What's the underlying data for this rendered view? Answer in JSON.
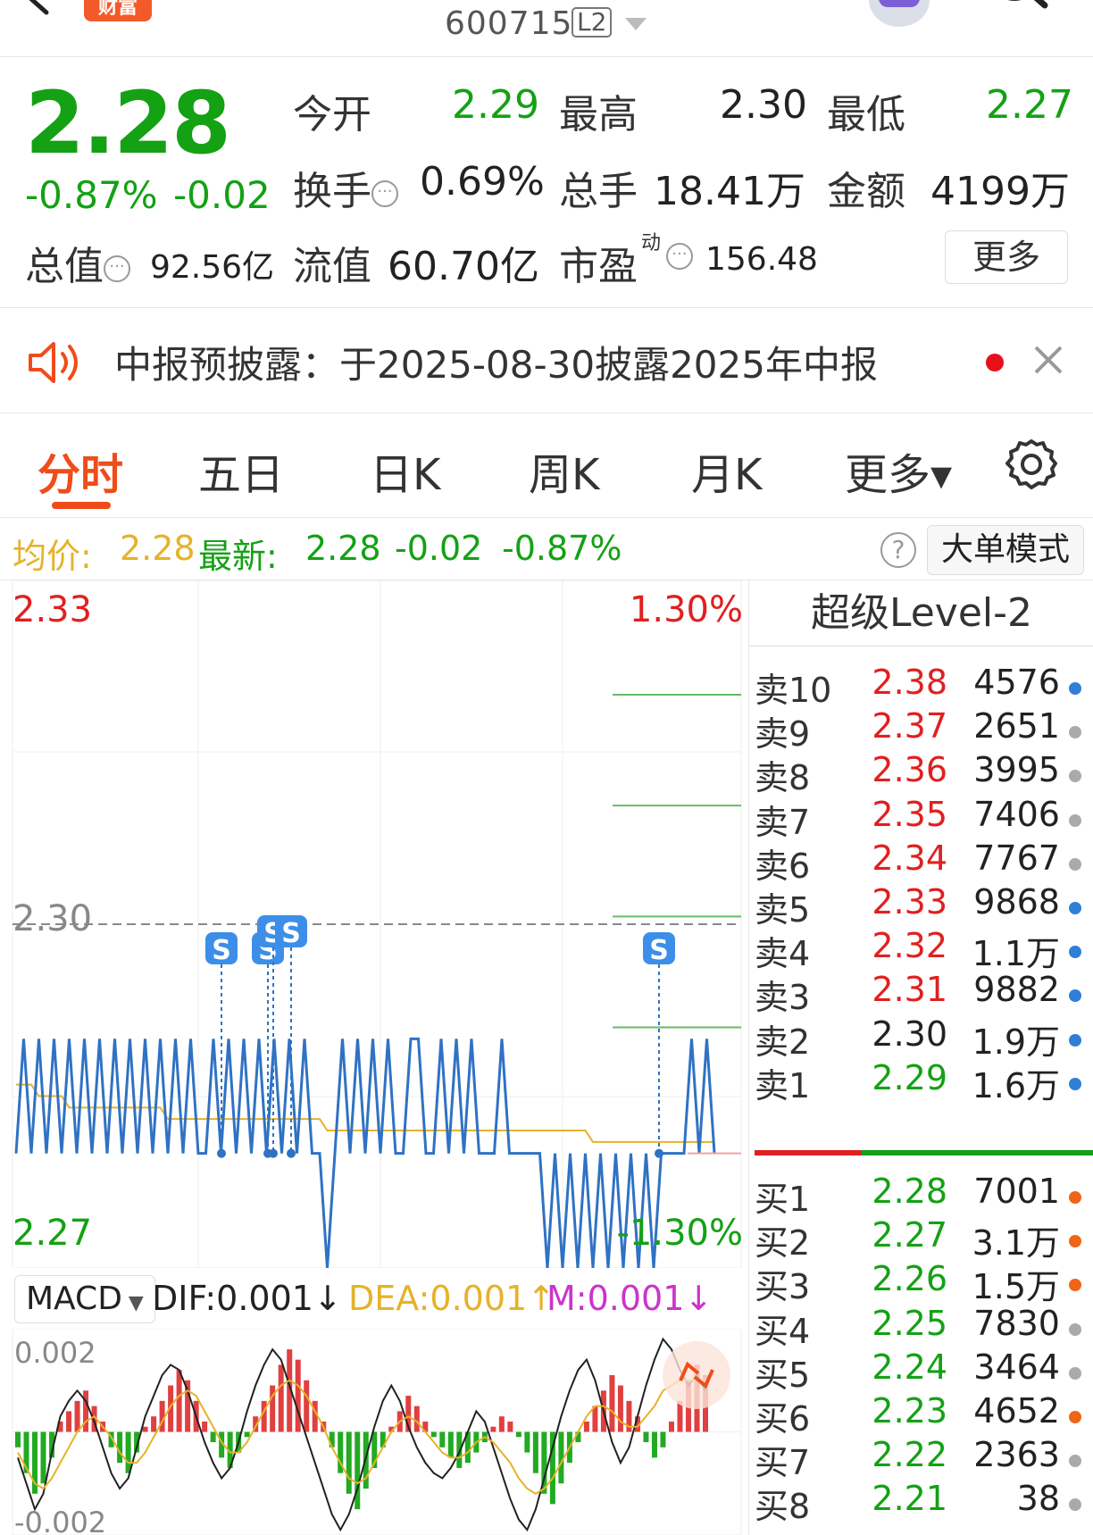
{
  "header": {
    "brand_text": "财富",
    "stock_code": "600715",
    "level_badge": "L2"
  },
  "quote": {
    "price": "2.28",
    "change_pct": "-0.87%",
    "change_amt": "-0.02",
    "open_label": "今开",
    "open_value": "2.29",
    "high_label": "最高",
    "high_value": "2.30",
    "low_label": "最低",
    "low_value": "2.27",
    "turnover_label": "换手",
    "turnover_value": "0.69%",
    "volume_label": "总手",
    "volume_value": "18.41万",
    "amount_label": "金额",
    "amount_value": "4199万",
    "mktcap_label": "总值",
    "mktcap_value": "92.56亿",
    "float_label": "流值",
    "float_value": "60.70亿",
    "pe_label": "市盈",
    "pe_sup": "动",
    "pe_value": "156.48",
    "more_label": "更多"
  },
  "notice": {
    "text": "中报预披露：于2025-08-30披露2025年中报"
  },
  "tabs": [
    {
      "label": "分时"
    },
    {
      "label": "五日"
    },
    {
      "label": "日K"
    },
    {
      "label": "周K"
    },
    {
      "label": "月K"
    },
    {
      "label": "更多▾"
    }
  ],
  "chart_info": {
    "avg_label": "均价:",
    "avg_value": "2.28",
    "latest_label": "最新:",
    "latest_value": "2.28",
    "latest_change": "-0.02",
    "latest_pct": "-0.87%",
    "help_label": "?",
    "big_order_label": "大单模式"
  },
  "chart_data": [
    {
      "type": "line",
      "y_top_label": "2.33",
      "y_mid_label": "2.30",
      "y_bottom_label": "2.27",
      "pct_top_label": "1.30%",
      "pct_bottom_label": "-1.30%",
      "ylim": [
        2.27,
        2.33
      ],
      "reference_price": 2.3,
      "s_marker_label": "S",
      "series": [
        {
          "values": [
            2.28,
            2.29,
            2.28,
            2.29,
            2.28,
            2.29,
            2.28,
            2.29,
            2.28,
            2.29,
            2.28,
            2.29,
            2.28,
            2.29,
            2.28,
            2.29,
            2.28,
            2.29,
            2.28,
            2.29,
            2.28,
            2.29,
            2.28,
            2.29,
            2.28,
            2.28,
            2.29,
            2.28,
            2.29,
            2.28,
            2.29,
            2.28,
            2.29,
            2.28,
            2.29,
            2.28,
            2.29,
            2.28,
            2.29,
            2.28,
            2.28,
            2.27,
            2.28,
            2.29,
            2.28,
            2.29,
            2.28,
            2.29,
            2.28,
            2.29,
            2.28,
            2.28,
            2.29,
            2.29,
            2.28,
            2.28,
            2.29,
            2.28,
            2.29,
            2.28,
            2.29,
            2.28,
            2.28,
            2.28,
            2.29,
            2.28,
            2.28,
            2.28,
            2.28,
            2.28,
            2.27,
            2.28,
            2.27,
            2.28,
            2.27,
            2.28,
            2.27,
            2.28,
            2.27,
            2.28,
            2.27,
            2.28,
            2.27,
            2.28,
            2.27,
            2.28,
            2.28,
            2.28,
            2.28,
            2.29,
            2.28,
            2.29,
            2.28
          ]
        },
        {
          "values": [
            2.286,
            2.286,
            2.286,
            2.285,
            2.285,
            2.285,
            2.285,
            2.284,
            2.284,
            2.284,
            2.284,
            2.284,
            2.284,
            2.284,
            2.284,
            2.284,
            2.284,
            2.284,
            2.284,
            2.284,
            2.283,
            2.283,
            2.283,
            2.283,
            2.283,
            2.283,
            2.283,
            2.283,
            2.283,
            2.283,
            2.283,
            2.283,
            2.283,
            2.283,
            2.283,
            2.283,
            2.283,
            2.283,
            2.283,
            2.283,
            2.283,
            2.282,
            2.282,
            2.282,
            2.282,
            2.282,
            2.282,
            2.282,
            2.282,
            2.282,
            2.282,
            2.282,
            2.282,
            2.282,
            2.282,
            2.282,
            2.282,
            2.282,
            2.282,
            2.282,
            2.282,
            2.282,
            2.282,
            2.282,
            2.282,
            2.282,
            2.282,
            2.282,
            2.282,
            2.282,
            2.282,
            2.282,
            2.282,
            2.282,
            2.282,
            2.282,
            2.281,
            2.281,
            2.281,
            2.281,
            2.281,
            2.281,
            2.281,
            2.281,
            2.281,
            2.281,
            2.281,
            2.281,
            2.281,
            2.281,
            2.281,
            2.281,
            2.281
          ]
        }
      ]
    },
    {
      "type": "bar",
      "indicator": "MACD",
      "dif_text": "DIF:0.001↓",
      "dea_text": "DEA:0.001↑",
      "m_text": "M:0.001↓",
      "y_top_label": "0.002",
      "y_bottom_label": "-0.002",
      "ylim": [
        -0.002,
        0.002
      ],
      "series": [
        {
          "values": [
            -0.0003,
            -0.0008,
            -0.0012,
            -0.001,
            -0.0005,
            0.0002,
            0.0004,
            0.0006,
            0.0008,
            0.0005,
            0.0002,
            -0.0003,
            -0.0006,
            -0.0008,
            -0.0004,
            0.0001,
            0.0003,
            0.0006,
            0.0009,
            0.0012,
            0.001,
            0.0006,
            0.0002,
            -0.0002,
            -0.0005,
            -0.0007,
            -0.0004,
            -0.0001,
            0.0003,
            0.0006,
            0.0009,
            0.0013,
            0.0016,
            0.0014,
            0.001,
            0.0006,
            0.0002,
            -0.0003,
            -0.0008,
            -0.0012,
            -0.0015,
            -0.0011,
            -0.0007,
            -0.0003,
            0.0001,
            0.0004,
            0.0007,
            0.0005,
            0.0002,
            -0.0001,
            -0.0003,
            -0.0005,
            -0.0007,
            -0.0006,
            -0.0004,
            -0.0002,
            0.0001,
            0.0003,
            0.0002,
            -0.0001,
            -0.0004,
            -0.0008,
            -0.0012,
            -0.0014,
            -0.001,
            -0.0006,
            -0.0002,
            0.0002,
            0.0005,
            0.0008,
            0.0011,
            0.0009,
            0.0006,
            0.0003,
            -0.0002,
            -0.0005,
            -0.0003,
            0.0002,
            0.0006,
            0.001,
            0.0013,
            0.0011
          ]
        },
        {
          "values": [
            -0.0005,
            -0.001,
            -0.0015,
            -0.0012,
            -0.0004,
            0.0003,
            0.0006,
            0.0008,
            0.0006,
            0.0002,
            -0.0003,
            -0.0008,
            -0.0011,
            -0.0009,
            -0.0003,
            0.0003,
            0.0007,
            0.0011,
            0.0013,
            0.0012,
            0.0008,
            0.0003,
            -0.0002,
            -0.0006,
            -0.0009,
            -0.0007,
            -0.0002,
            0.0004,
            0.0009,
            0.0013,
            0.0016,
            0.0014,
            0.0009,
            0.0004,
            -0.0001,
            -0.0006,
            -0.0011,
            -0.0016,
            -0.0019,
            -0.0016,
            -0.0011,
            -0.0005,
            0.0001,
            0.0006,
            0.0009,
            0.0006,
            0.0001,
            -0.0003,
            -0.0006,
            -0.0008,
            -0.0009,
            -0.0007,
            -0.0004,
            0.0,
            0.0004,
            0.0002,
            -0.0003,
            -0.0008,
            -0.0013,
            -0.0017,
            -0.0019,
            -0.0015,
            -0.0009,
            -0.0003,
            0.0003,
            0.0008,
            0.0012,
            0.0014,
            0.001,
            0.0004,
            -0.0002,
            -0.0006,
            -0.0003,
            0.0003,
            0.0009,
            0.0014,
            0.0018,
            0.0016,
            0.0012,
            0.0009,
            0.0011,
            0.0008
          ]
        },
        {
          "values": [
            -0.0004,
            -0.0007,
            -0.001,
            -0.0011,
            -0.0009,
            -0.0006,
            -0.0003,
            0.0,
            0.0002,
            0.0003,
            0.0001,
            -0.0001,
            -0.0004,
            -0.0006,
            -0.0006,
            -0.0004,
            -0.0001,
            0.0002,
            0.0005,
            0.0007,
            0.0008,
            0.0007,
            0.0004,
            0.0001,
            -0.0002,
            -0.0004,
            -0.0004,
            -0.0002,
            0.0001,
            0.0004,
            0.0007,
            0.0009,
            0.001,
            0.0009,
            0.0007,
            0.0004,
            0.0001,
            -0.0003,
            -0.0006,
            -0.0009,
            -0.001,
            -0.0009,
            -0.0006,
            -0.0003,
            0.0,
            0.0002,
            0.0003,
            0.0002,
            0.0,
            -0.0002,
            -0.0004,
            -0.0005,
            -0.0005,
            -0.0004,
            -0.0002,
            -0.0001,
            -0.0002,
            -0.0004,
            -0.0006,
            -0.0009,
            -0.0011,
            -0.0012,
            -0.0011,
            -0.0009,
            -0.0006,
            -0.0003,
            0.0,
            0.0003,
            0.0005,
            0.0005,
            0.0004,
            0.0002,
            0.0001,
            0.0001,
            0.0003,
            0.0005,
            0.0008,
            0.0009,
            0.001,
            0.001,
            0.001,
            0.001
          ]
        }
      ]
    }
  ],
  "orderbook": {
    "title": "超级Level-2",
    "sell": [
      {
        "label": "卖10",
        "price": "2.38",
        "vol": "4576",
        "dot": "#2f7fd8"
      },
      {
        "label": "卖9",
        "price": "2.37",
        "vol": "2651",
        "dot": "#aaaaaa"
      },
      {
        "label": "卖8",
        "price": "2.36",
        "vol": "3995",
        "dot": "#aaaaaa"
      },
      {
        "label": "卖7",
        "price": "2.35",
        "vol": "7406",
        "dot": "#aaaaaa"
      },
      {
        "label": "卖6",
        "price": "2.34",
        "vol": "7767",
        "dot": "#aaaaaa"
      },
      {
        "label": "卖5",
        "price": "2.33",
        "vol": "9868",
        "dot": "#2f7fd8"
      },
      {
        "label": "卖4",
        "price": "2.32",
        "vol": "1.1万",
        "dot": "#2f7fd8"
      },
      {
        "label": "卖3",
        "price": "2.31",
        "vol": "9882",
        "dot": "#2f7fd8"
      },
      {
        "label": "卖2",
        "price": "2.30",
        "vol": "1.9万",
        "dot": "#2f7fd8"
      },
      {
        "label": "卖1",
        "price": "2.29",
        "vol": "1.6万",
        "dot": "#2f7fd8"
      }
    ],
    "buy": [
      {
        "label": "买1",
        "price": "2.28",
        "vol": "7001",
        "dot": "#f06418"
      },
      {
        "label": "买2",
        "price": "2.27",
        "vol": "3.1万",
        "dot": "#f06418"
      },
      {
        "label": "买3",
        "price": "2.26",
        "vol": "1.5万",
        "dot": "#f06418"
      },
      {
        "label": "买4",
        "price": "2.25",
        "vol": "7830",
        "dot": "#aaaaaa"
      },
      {
        "label": "买5",
        "price": "2.24",
        "vol": "3464",
        "dot": "#aaaaaa"
      },
      {
        "label": "买6",
        "price": "2.23",
        "vol": "4652",
        "dot": "#f06418"
      },
      {
        "label": "买7",
        "price": "2.22",
        "vol": "2363",
        "dot": "#aaaaaa"
      },
      {
        "label": "买8",
        "price": "2.21",
        "vol": "38",
        "dot": "#aaaaaa"
      }
    ]
  },
  "colors": {
    "accent": "#ef4c1a",
    "up": "#e02020",
    "down": "#14a114",
    "price_line": "#2f72c4",
    "avg_line": "#e5b22a"
  }
}
